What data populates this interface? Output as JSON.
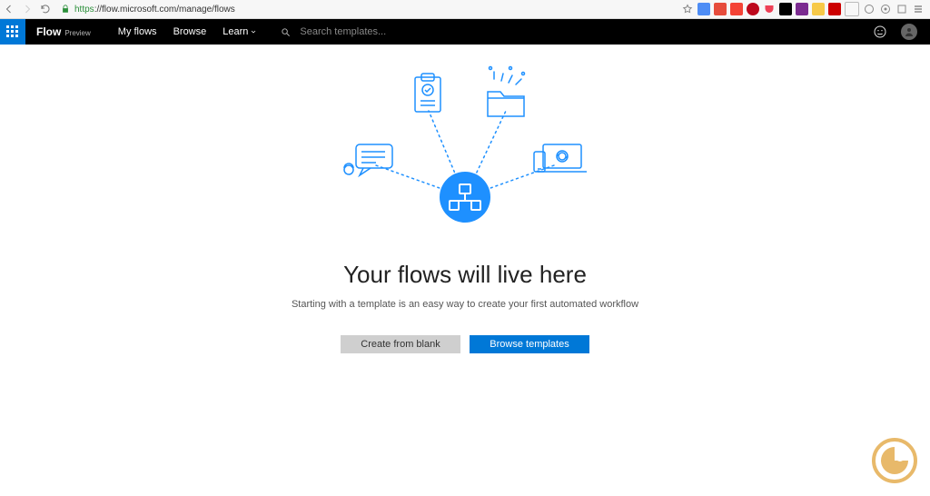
{
  "browser": {
    "url_scheme": "https",
    "url_rest": "://flow.microsoft.com/manage/flows",
    "star_title": "Bookmark"
  },
  "app": {
    "brand": "Flow",
    "brand_tag": "Preview",
    "nav": {
      "my_flows": "My flows",
      "browse": "Browse",
      "learn": "Learn"
    },
    "search_placeholder": "Search templates..."
  },
  "empty_state": {
    "headline": "Your flows will live here",
    "subline": "Starting with a template is an easy way to create your first automated workflow",
    "create_blank": "Create from blank",
    "browse_templates": "Browse templates"
  }
}
